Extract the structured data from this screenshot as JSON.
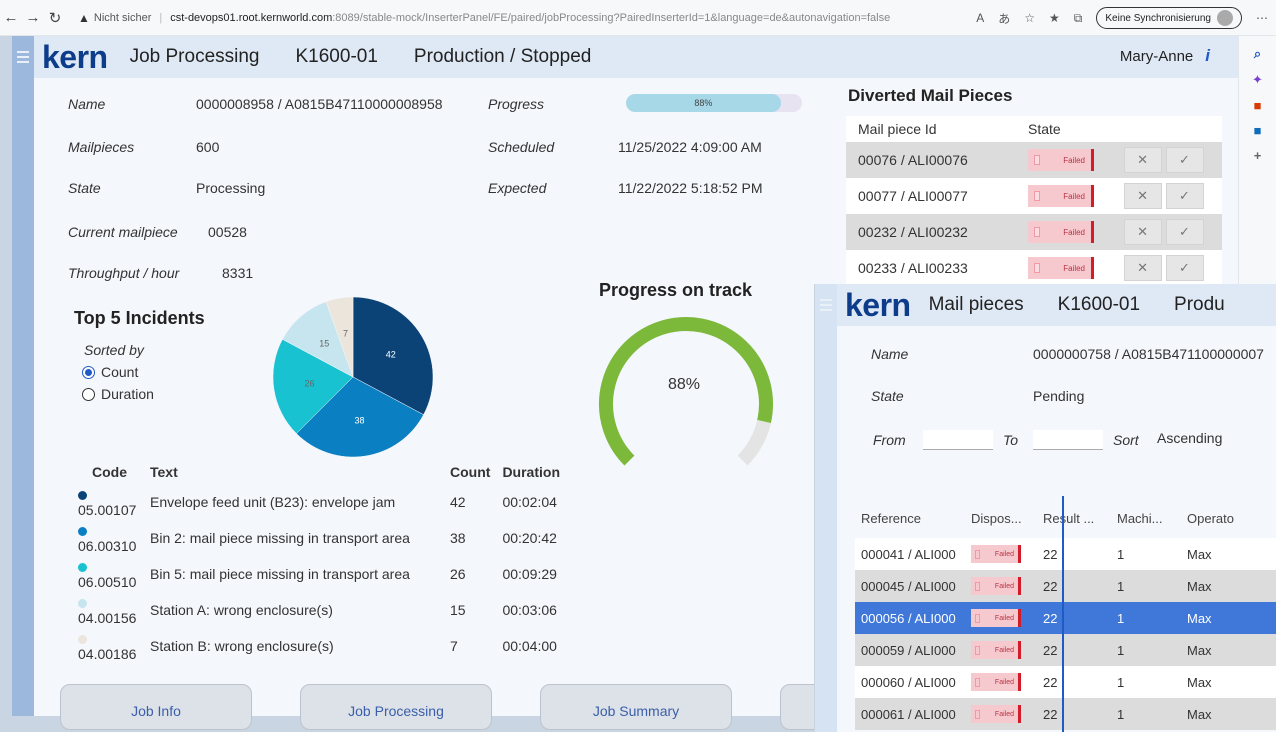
{
  "browser": {
    "security": "Nicht sicher",
    "host": "cst-devops01.root.kernworld.com",
    "path": ":8089/stable-mock/InserterPanel/FE/paired/jobProcessing?PairedInserterId=1&language=de&autonavigation=false",
    "sync": "Keine Synchronisierung"
  },
  "header": {
    "logo": "kern",
    "title": "Job Processing",
    "machine": "K1600-01",
    "status": "Production / Stopped",
    "user": "Mary-Anne",
    "info_glyph": "i"
  },
  "job": {
    "name_label": "Name",
    "name": "0000008958 / A0815B47110000008958",
    "mailpieces_label": "Mailpieces",
    "mailpieces": "600",
    "state_label": "State",
    "state": "Processing",
    "current_label": "Current mailpiece",
    "current": "00528",
    "throughput_label": "Throughput / hour",
    "throughput": "8331",
    "progress_label": "Progress",
    "progress": "88%",
    "progress_value": 0.88,
    "scheduled_label": "Scheduled",
    "scheduled": "11/25/2022 4:09:00 AM",
    "expected_label": "Expected",
    "expected": "11/22/2022 5:18:52 PM"
  },
  "incidents": {
    "title": "Top 5 Incidents",
    "sorted_by": "Sorted by",
    "opt_count": "Count",
    "opt_duration": "Duration",
    "head_code": "Code",
    "head_text": "Text",
    "head_count": "Count",
    "head_duration": "Duration",
    "rows": [
      {
        "code": "05.00107",
        "text": "Envelope feed unit (B23): envelope jam",
        "count": "42",
        "duration": "00:02:04",
        "color": "#0c4377"
      },
      {
        "code": "06.00310",
        "text": "Bin 2: mail piece missing in transport area",
        "count": "38",
        "duration": "00:20:42",
        "color": "#0a7fc1"
      },
      {
        "code": "06.00510",
        "text": "Bin 5: mail piece missing in transport area",
        "count": "26",
        "duration": "00:09:29",
        "color": "#19c2d1"
      },
      {
        "code": "04.00156",
        "text": "Station A: wrong enclosure(s)",
        "count": "15",
        "duration": "00:03:06",
        "color": "#c6e5ee"
      },
      {
        "code": "04.00186",
        "text": "Station B: wrong enclosure(s)",
        "count": "7",
        "duration": "00:04:00",
        "color": "#ece5dc"
      }
    ]
  },
  "chart_data": {
    "type": "pie",
    "categories": [
      "05.00107",
      "06.00310",
      "06.00510",
      "04.00156",
      "04.00186"
    ],
    "values": [
      42,
      38,
      26,
      15,
      7
    ],
    "colors": [
      "#0c4377",
      "#0a7fc1",
      "#19c2d1",
      "#c6e5ee",
      "#ece5dc"
    ]
  },
  "gauge": {
    "title": "Progress on track",
    "label": "88%",
    "value": 0.88,
    "color": "#7cb93a"
  },
  "diverted": {
    "title": "Diverted Mail Pieces",
    "head_id": "Mail piece Id",
    "head_state": "State",
    "fail_label": "Failed",
    "reject_glyph": "✕",
    "accept_glyph": "✓",
    "rows": [
      {
        "id": "00076 / ALI00076"
      },
      {
        "id": "00077 / ALI00077"
      },
      {
        "id": "00232 / ALI00232"
      },
      {
        "id": "00233 / ALI00233"
      }
    ]
  },
  "tabs": [
    "Job Info",
    "Job Processing",
    "Job Summary"
  ],
  "overlay": {
    "logo": "kern",
    "title": "Mail pieces",
    "machine": "K1600-01",
    "status": "Produ",
    "name_label": "Name",
    "name": "0000000758 / A0815B471100000007",
    "state_label": "State",
    "state": "Pending",
    "from_label": "From",
    "to_label": "To",
    "sort_label": "Sort",
    "sort_value": "Ascending",
    "columns": [
      "Reference",
      "Dispos...",
      "Result ...",
      "Machi...",
      "Operato"
    ],
    "fail_label": "Failed",
    "rows": [
      {
        "ref": "000041 / ALI000",
        "result": "22",
        "machine": "1",
        "operator": "Max"
      },
      {
        "ref": "000045 / ALI000",
        "result": "22",
        "machine": "1",
        "operator": "Max"
      },
      {
        "ref": "000056 / ALI000",
        "result": "22",
        "machine": "1",
        "operator": "Max"
      },
      {
        "ref": "000059 / ALI000",
        "result": "22",
        "machine": "1",
        "operator": "Max"
      },
      {
        "ref": "000060 / ALI000",
        "result": "22",
        "machine": "1",
        "operator": "Max"
      },
      {
        "ref": "000061 / ALI000",
        "result": "22",
        "machine": "1",
        "operator": "Max"
      }
    ]
  }
}
